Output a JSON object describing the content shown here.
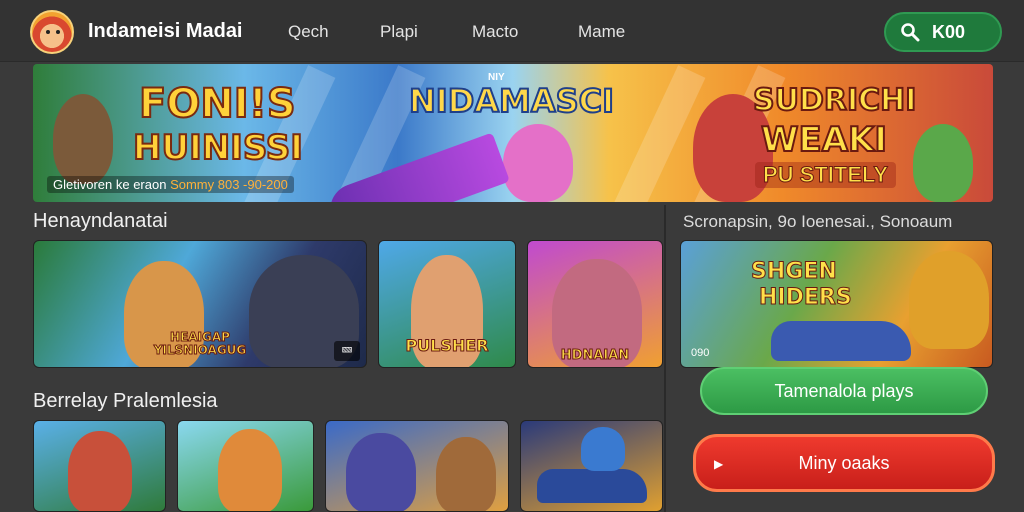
{
  "header": {
    "brand": "Indameisi Madai",
    "nav": [
      "Qech",
      "Plapi",
      "Macto",
      "Mame"
    ],
    "search_label": "K00"
  },
  "hero": {
    "title_line1": "FONI!S",
    "title_line2": "HUINISSI",
    "tagline_prefix": "Gletivoren ke eraon",
    "tagline_highlight": "Sommy 803 -90-200",
    "center_badge": "NIY",
    "center_title": "NIDAMASCI",
    "right_line1": "SUDRICHI",
    "right_line2": "WEAKI",
    "right_line3": "PU STITELY"
  },
  "section_featured": {
    "title": "Henayndanatai",
    "tiles": [
      {
        "caption": "HEAIGAP\nYILSNIOAGUG",
        "badge": "🝙"
      },
      {
        "caption": "PULSHER",
        "badge": ""
      },
      {
        "caption": "HDNAIAN",
        "badge": ""
      }
    ]
  },
  "section_side": {
    "meta": "Scronapsin, 9o Ioenesai., Sonoaum",
    "tile_caption_1": "SHGEN",
    "tile_caption_2": "HIDERS",
    "tile_counter": "090",
    "green_button": "Tamenalola plays",
    "red_button": "Miny oaaks"
  },
  "section_popular": {
    "title": "Berrelay Pralemlesia",
    "tiles": [
      {
        "caption": ""
      },
      {
        "caption": ""
      },
      {
        "caption": ""
      },
      {
        "caption": ""
      }
    ]
  },
  "colors": {
    "background": "#3a3a3a",
    "accent_green": "#2d9a45",
    "accent_red": "#c81f1a",
    "title_yellow": "#ffd23a"
  }
}
